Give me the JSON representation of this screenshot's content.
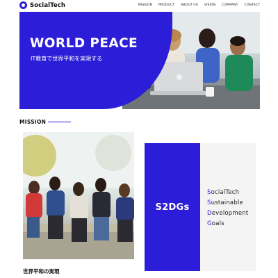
{
  "colors": {
    "accent": "#2c1ed8",
    "card_bg": "#f4f4f4"
  },
  "header": {
    "logo_icon": "socialtech-logo-icon",
    "brand": "SocialTech",
    "nav": [
      "MISSION",
      "PRODUCT",
      "ABOUT US",
      "VISION",
      "COMPANY",
      "CONTACT"
    ]
  },
  "hero": {
    "title": "WORLD PEACE",
    "subtitle": "IT教育で世界平和を実現する",
    "image": "group-with-laptop-photo"
  },
  "mission": {
    "heading": "MISSION",
    "image": "group-of-friends-photo",
    "caption": "世界平和の実現"
  },
  "s2dgs": {
    "title": "S2DGs",
    "lines": [
      {
        "initial": "S",
        "rest": "ocialTech"
      },
      {
        "initial": "S",
        "rest": "ustainable"
      },
      {
        "initial": "D",
        "rest": "evelopment"
      },
      {
        "initial": "G",
        "rest": "oals"
      }
    ]
  }
}
